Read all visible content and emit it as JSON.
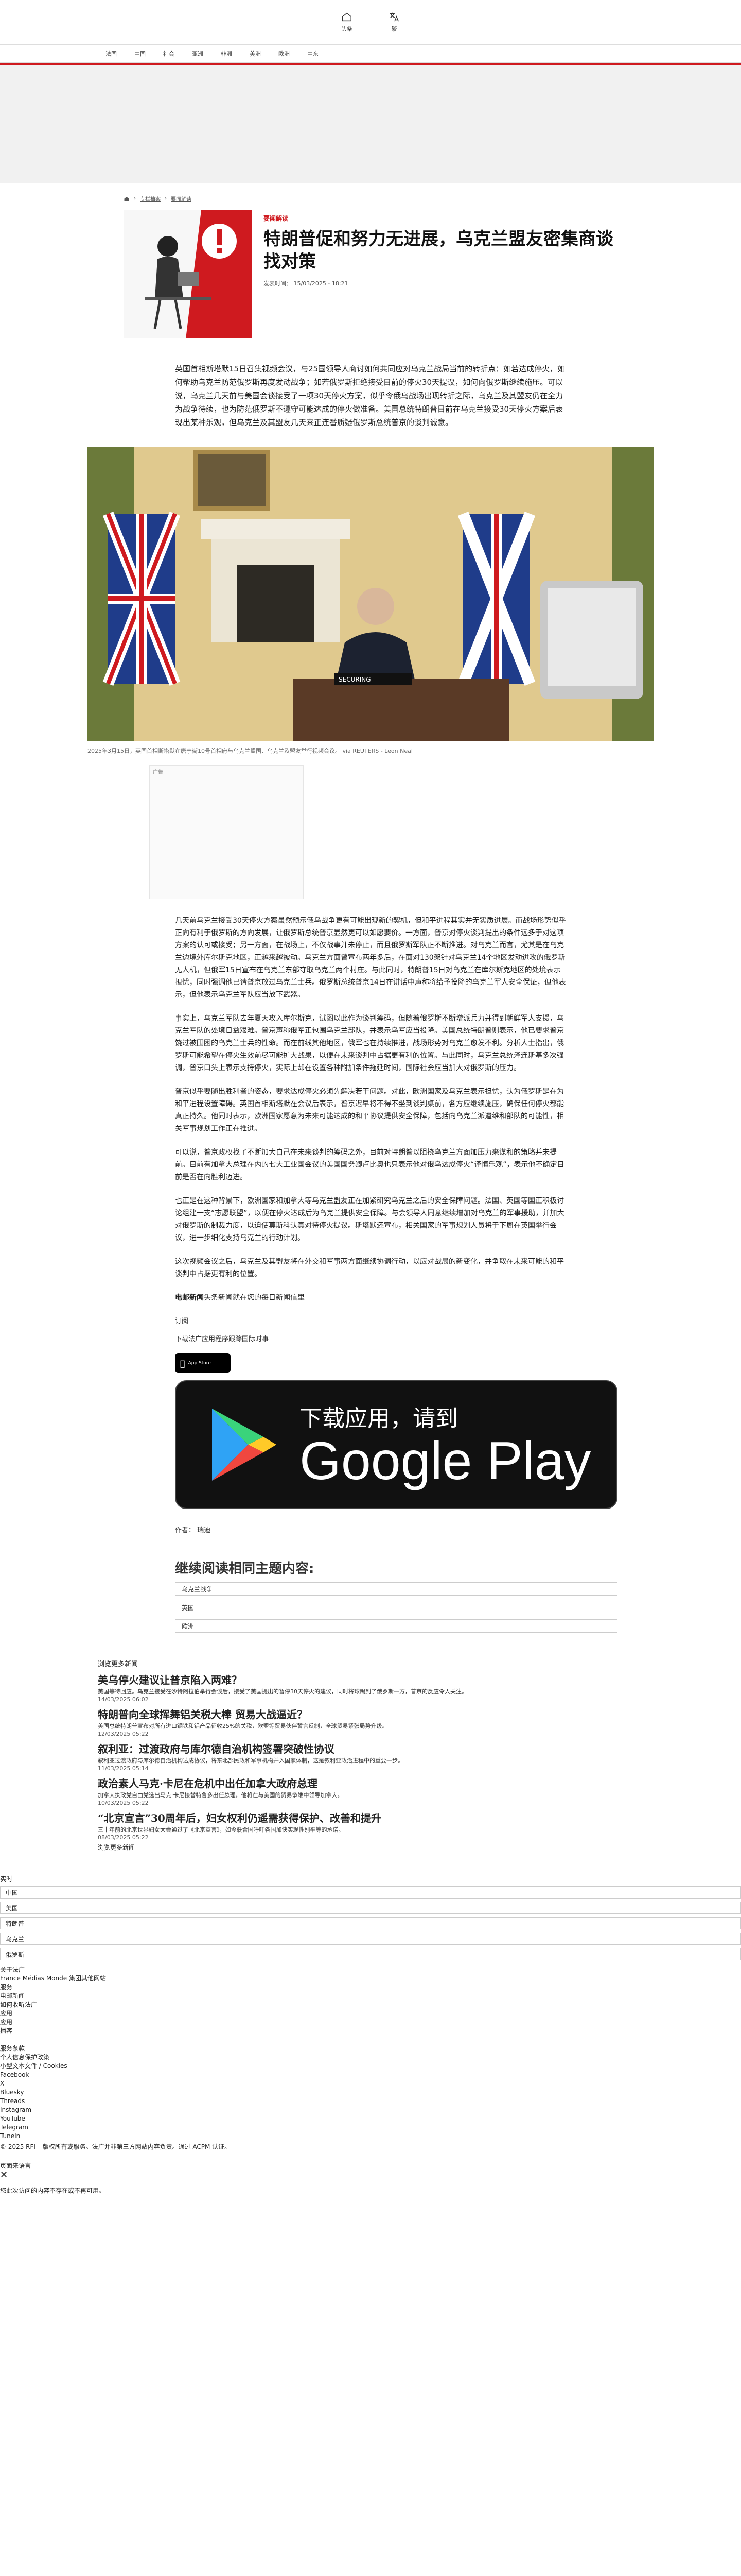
{
  "topbar": {
    "home_label": "头条",
    "text_label": "繁"
  },
  "nav": [
    "法国",
    "中国",
    "社会",
    "亚洲",
    "非洲",
    "美洲",
    "欧洲",
    "中东"
  ],
  "breadcrumb": [
    "专栏档案",
    "要闻解读"
  ],
  "article": {
    "kicker": "要闻解读",
    "title": "特朗普促和努力无进展，乌克兰盟友密集商谈找对策",
    "pubdate": "发表时间： 15/03/2025 - 18:21",
    "lede": "英国首相斯塔默15日召集视频会议，与25国领导人商讨如何共同应对乌克兰战局当前的转折点：如若达成停火，如何帮助乌克兰防范俄罗斯再度发动战争；如若俄罗斯拒绝接受目前的停火30天提议，如何向俄罗斯继续施压。可以说，乌克兰几天前与美国会谈接受了一项30天停火方案，似乎令俄乌战场出现转折之际，乌克兰及其盟友仍在全力为战争待续，也为防范俄罗斯不遵守可能达成的停火做准备。美国总统特朗普目前在乌克兰接受30天停火方案后表现出某种乐观，但乌克兰及其盟友几天来正连番质疑俄罗斯总统普京的谈判诚意。",
    "photo_caption": "2025年3月15日，英国首相斯塔默在唐宁街10号首相府与乌克兰盟国、乌克兰及盟友举行视频会议。  via REUTERS - Leon Neal",
    "photo_sign": "SECURING",
    "ad_label": "广告",
    "paragraphs": [
      "几天前乌克兰接受30天停火方案虽然预示俄乌战争更有可能出现新的契机，但和平进程其实并无实质进展。而战场形势似乎正向有利于俄罗斯的方向发展，让俄罗斯总统普京显然更可以如愿要价。一方面，普京对停火谈判提出的条件远多于对这项方案的认可或接受；另一方面，在战场上，不仅战事并未停止，而且俄罗斯军队正不断推进。对乌克兰而言，尤其是在乌克兰边境外库尔斯克地区，正越来越被动。乌克兰方面曾宣布两年多后，在面对130架针对乌克兰14个地区发动进攻的俄罗斯无人机，但俄军15日宣布在乌克兰东部夺取乌克兰两个村庄。与此同时，特朗普15日对乌克兰在库尔斯克地区的处境表示担忧，同时强调他已请普京放过乌克兰士兵。俄罗斯总统普京14日在讲话中声称将给予投降的乌克兰军人安全保证，但他表示，但他表示乌克兰军队应当放下武器。",
      "事实上，乌克兰军队去年夏天攻入库尔斯克，试图以此作为谈判筹码，但随着俄罗斯不断增派兵力并得到朝鲜军人支援，乌克兰军队的处境日益艰难。普京声称俄军正包围乌克兰部队，并表示乌军应当投降。美国总统特朗普则表示，他已要求普京饶过被围困的乌克兰士兵的性命。而在前线其他地区，俄军也在持续推进，战场形势对乌克兰愈发不利。分析人士指出，俄罗斯可能希望在停火生效前尽可能扩大战果，以便在未来谈判中占据更有利的位置。与此同时，乌克兰总统泽连斯基多次强调，普京口头上表示支持停火，实际上却在设置各种附加条件拖延时间，国际社会应当加大对俄罗斯的压力。",
      "普京似乎要随出胜利者的姿态，要求达成停火必须先解决若干问题。对此，欧洲国家及乌克兰表示担忧，认为俄罗斯是在为和平进程设置障碍。英国首相斯塔默在会议后表示，普京迟早将不得不坐到谈判桌前，各方应继续施压，确保任何停火都能真正持久。他同时表示，欧洲国家愿意为未来可能达成的和平协议提供安全保障，包括向乌克兰派遣维和部队的可能性，相关军事规划工作正在推进。",
      "可以说，普京政权找了不断加大自己在未来谈判的筹码之外，目前对特朗普以阻挠乌克兰方面加压力来谋和的策略并未提前。目前有加拿大总理在内的七大工业国会议的美国国务卿卢比奥也只表示他对俄乌达成停火“谨慎乐观”，表示他不确定目前是否在向胜利迈进。",
      "也正是在这种背景下，欧洲国家和加拿大等乌克兰盟友正在加紧研究乌克兰之后的安全保障问题。法国、英国等国正积极讨论组建一支“志愿联盟”，以便在停火达成后为乌克兰提供安全保障。与会领导人同意继续增加对乌克兰的军事援助，并加大对俄罗斯的制裁力度，以迫使莫斯科认真对待停火提议。斯塔默还宣布，相关国家的军事规划人员将于下周在英国举行会议，进一步细化支持乌克兰的行动计划。",
      "这次视频会议之后，乌克兰及其盟友将在外交和军事两方面继续协调行动，以应对战局的新变化，并争取在未来可能的和平谈判中占据更有利的位置。"
    ],
    "closing_label": "电邮新闻",
    "closing_text": "头条新闻就在您的每日新闻信里",
    "subscribe_label": "订阅",
    "download_label": "下载法广应用程序跟踪国际时事",
    "appstore_label": "App Store",
    "gplay_line1": "下载应用，请到",
    "gplay_line2": "Google Play",
    "author": "作者： 瑞迪"
  },
  "related": {
    "title": "继续阅读相同主题内容:",
    "items": [
      "乌克兰战争",
      "英国",
      "欧洲"
    ]
  },
  "more": {
    "label": "浏览更多新闻",
    "items": [
      {
        "title": "美乌停火建议让普京陷入两难？",
        "text": "美国等待回应。乌克兰接受在沙特阿拉伯举行会谈后，接受了美国提出的暂停30天停火的建议，同时将球踢到了俄罗斯一方，普京的反应令人关注。",
        "date": "14/03/2025 06:02"
      },
      {
        "title": "特朗普向全球挥舞铝关税大棒 贸易大战逼近？",
        "text": "美国总统特朗普宣布对所有进口钢铁和铝产品征收25%的关税，欧盟等贸易伙伴誓言反制，全球贸易紧张局势升级。",
        "date": "12/03/2025 05:22"
      },
      {
        "title": "叙利亚：过渡政府与库尔德自治机构签署突破性协议",
        "text": "叙利亚过渡政府与库尔德自治机构达成协议，将东北部民政和军事机构并入国家体制，这是叙利亚政治进程中的重要一步。",
        "date": "11/03/2025 05:14"
      },
      {
        "title": "政治素人马克·卡尼在危机中出任加拿大政府总理",
        "text": "加拿大执政党自由党选出马克·卡尼接替特鲁多出任总理，他将在与美国的贸易争端中领导加拿大。",
        "date": "10/03/2025 05:22"
      },
      {
        "title": "“北京宣言”30周年后，妇女权利仍遥需获得保护、改善和提升",
        "text": "三十年前的北京世界妇女大会通过了《北京宣言》，如今联合国呼吁各国加快实现性别平等的承诺。",
        "date": "08/03/2025 05:22"
      }
    ],
    "more_link": "浏览更多新闻"
  },
  "footer": {
    "now_label": "实时",
    "rows": [
      "中国",
      "美国",
      "特朗普",
      "乌克兰",
      "俄罗斯"
    ],
    "links": [
      "关于法广",
      "France Médias Monde 集团其他网站",
      "服务",
      "电邮新闻",
      "如何收听法广",
      "应用",
      "应用",
      "播客",
      "",
      "服务条款",
      "个人信息保护政策",
      "小型文本文件 / Cookies",
      "Facebook",
      "X",
      "Bluesky",
      "Threads",
      "Instagram",
      "YouTube",
      "Telegram",
      "TuneIn"
    ],
    "copyright": "© 2025 RFI – 版权所有或服务。法广并非第三方网站内容负责。通过 ACPM 认证。",
    "lang_label": "页面来语言",
    "note": "您此次访问的内容不存在或不再可用。"
  },
  "colors": {
    "accent": "#cf1a1f",
    "dark": "#111111"
  }
}
